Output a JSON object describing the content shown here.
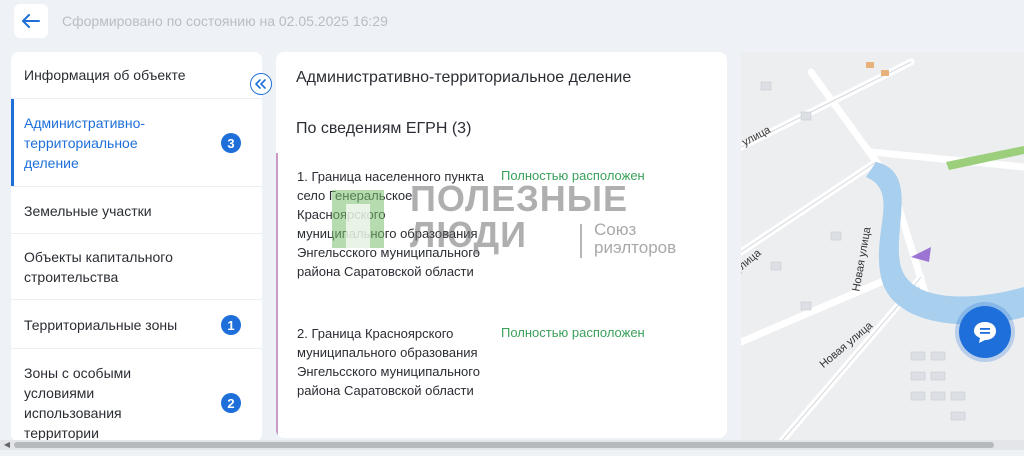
{
  "header": {
    "status_text": "Сформировано по состоянию на 02.05.2025 16:29"
  },
  "sidebar": {
    "items": [
      {
        "label": "Информация об объекте",
        "badge": ""
      },
      {
        "label": "Административно-территориальное деление",
        "badge": "3"
      },
      {
        "label": "Земельные участки",
        "badge": ""
      },
      {
        "label": "Объекты капитального строительства",
        "badge": ""
      },
      {
        "label": "Территориальные зоны",
        "badge": "1"
      },
      {
        "label": "Зоны с особыми условиями использования территории",
        "badge": "2"
      }
    ]
  },
  "content": {
    "title": "Административно-территориальное деление",
    "section_title": "По сведениям ЕГРН (3)",
    "records": [
      {
        "name": "1. Граница населенного пункта село Генеральское Красноярского муниципального образования Энгельсского муниципального района Саратовской области",
        "status": "Полностью расположен"
      },
      {
        "name": "2. Граница Красноярского муниципального образования Энгельсского муниципального района Саратовской области",
        "status": "Полностью расположен"
      }
    ]
  },
  "watermark": {
    "line1": "ПОЛЕЗНЫЕ",
    "line2": "ЛЮДИ",
    "sub1": "Союз",
    "sub2": "риэлторов"
  },
  "map": {
    "street_labels": [
      "улица",
      "Новая улица",
      "Новая улица",
      "улица"
    ]
  },
  "colors": {
    "accent": "#1e6fd9",
    "success": "#3aa05a",
    "divider": "#c79ac9"
  }
}
